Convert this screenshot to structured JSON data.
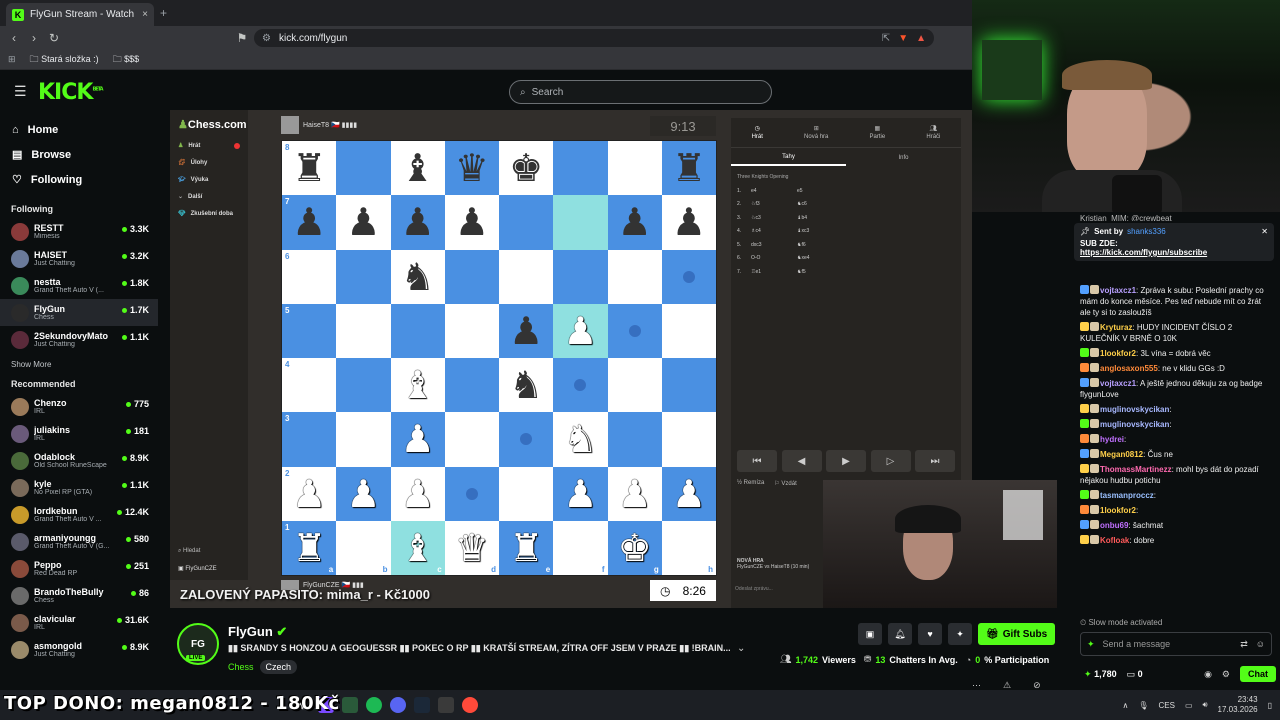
{
  "browser": {
    "tab_title": "FlyGun Stream - Watch Live o...",
    "tab_close": "×",
    "new_tab": "+",
    "url": "kick.com/flygun",
    "bookmarks": [
      "Stará složka :)",
      "$$$"
    ]
  },
  "kick": {
    "logo": "KICK",
    "logo_beta": "BETA",
    "search_placeholder": "Search"
  },
  "sidebar": {
    "nav": [
      {
        "label": "Home",
        "icon": "home-icon",
        "glyph": "⌂"
      },
      {
        "label": "Browse",
        "icon": "browse-icon",
        "glyph": "▤"
      },
      {
        "label": "Following",
        "icon": "heart-icon",
        "glyph": "♡"
      }
    ],
    "following_title": "Following",
    "following": [
      {
        "name": "RESTT",
        "sub": "Mimesis",
        "viewers": "3.3K",
        "color": "#8a3a3a"
      },
      {
        "name": "HAISET",
        "sub": "Just Chatting",
        "viewers": "3.2K",
        "color": "#6a7a9a"
      },
      {
        "name": "nestta",
        "sub": "Grand Theft Auto V (...",
        "viewers": "1.8K",
        "color": "#3a8a5a"
      },
      {
        "name": "FlyGun",
        "sub": "Chess",
        "viewers": "1.7K",
        "color": "#2a2a2a"
      },
      {
        "name": "2SekundovyMato",
        "sub": "Just Chatting",
        "viewers": "1.1K",
        "color": "#5a2a3a"
      }
    ],
    "show_more": "Show More",
    "recommended_title": "Recommended",
    "recommended": [
      {
        "name": "Chenzo",
        "sub": "IRL",
        "viewers": "775",
        "color": "#9a7a5a"
      },
      {
        "name": "juliakins",
        "sub": "IRL",
        "viewers": "181",
        "color": "#6a5a7a"
      },
      {
        "name": "Odablock",
        "sub": "Old School RuneScape",
        "viewers": "8.9K",
        "color": "#4a6a3a"
      },
      {
        "name": "kyle",
        "sub": "No Pixel RP (GTA)",
        "viewers": "1.1K",
        "color": "#7a6a5a"
      },
      {
        "name": "lordkebun",
        "sub": "Grand Theft Auto V ...",
        "viewers": "12.4K",
        "color": "#c89a2a"
      },
      {
        "name": "armaniyoungg",
        "sub": "Grand Theft Auto V (G...",
        "viewers": "580",
        "color": "#5a5a6a"
      },
      {
        "name": "Peppo",
        "sub": "Red Dead RP",
        "viewers": "251",
        "color": "#8a4a3a"
      },
      {
        "name": "BrandoTheBully",
        "sub": "Chess",
        "viewers": "86",
        "color": "#6a6a6a"
      },
      {
        "name": "clavicular",
        "sub": "IRL",
        "viewers": "31.6K",
        "color": "#7a5a4a"
      },
      {
        "name": "asmongold",
        "sub": "Just Chatting",
        "viewers": "8.9K",
        "color": "#9a8a6a"
      }
    ]
  },
  "chess": {
    "site": "Chess.com",
    "side_menu": [
      "Hrát",
      "Úlohy",
      "Výuka",
      "Další",
      "Zkušební doba"
    ],
    "side_bottom": [
      "Hledat",
      "FlyGunCZE"
    ],
    "opponent": "HaiseT8 🇨🇿 ▮▮▮▮",
    "player": "FlyGunCZE 🇨🇿 ▮▮▮",
    "clock_top": "9:13",
    "clock_bottom": "8:26",
    "board": [
      [
        "br",
        "",
        "bb",
        "bq",
        "bk",
        "",
        "",
        "br"
      ],
      [
        "bp",
        "bp",
        "bp",
        "bp",
        "",
        "hl",
        "bp",
        "bp"
      ],
      [
        "",
        "",
        "bn",
        "",
        "",
        "",
        "",
        "dot"
      ],
      [
        "",
        "",
        "",
        "",
        "bp",
        "wp*",
        "dot",
        ""
      ],
      [
        "",
        "",
        "wb",
        "",
        "bn",
        "dot",
        "",
        ""
      ],
      [
        "",
        "",
        "wp",
        "",
        "dot",
        "wn",
        "",
        ""
      ],
      [
        "wp",
        "wp",
        "wp",
        "dot",
        "",
        "wp",
        "wp",
        "wp"
      ],
      [
        "wr",
        "",
        "wb*",
        "wq",
        "wr",
        "",
        "wk",
        ""
      ]
    ],
    "files": [
      "a",
      "b",
      "c",
      "d",
      "e",
      "f",
      "g",
      "h"
    ],
    "ranks": [
      "8",
      "7",
      "6",
      "5",
      "4",
      "3",
      "2",
      "1"
    ],
    "panel_tabs": [
      "Hrát",
      "Nová hra",
      "Partie",
      "Hráči"
    ],
    "subtabs": [
      "Tahy",
      "Info"
    ],
    "opening": "Three Knights Opening",
    "moves": [
      [
        "1.",
        "e4",
        "e5"
      ],
      [
        "2.",
        "♘f3",
        "♞c6"
      ],
      [
        "3.",
        "♘c3",
        "♝b4"
      ],
      [
        "4.",
        "♗c4",
        "♝xc3"
      ],
      [
        "5.",
        "dxc3",
        "♞f6"
      ],
      [
        "6.",
        "O-O",
        "♞xe4"
      ],
      [
        "7.",
        "♖e1",
        "♞f5"
      ]
    ],
    "nav_buttons": [
      "⏮",
      "◀",
      "▶",
      "▷",
      "⏭"
    ],
    "draw": "Remíza",
    "resign": "Vzdát",
    "new_game_title": "NOVÁ HRA",
    "new_game_sub": "FlyGunCZE vs HaiseT8 (10 min)",
    "send_msg": "Odeslat zprávu..."
  },
  "overlay_banner": "ZALOVENÝ PAPASITO: mima_r - Kč1000",
  "stream": {
    "channel": "FlyGun",
    "title": "▮▮ SRANDY S HONZOU A GEOGUESSR  ▮▮ POKEC O RP  ▮▮ KRATŠÍ STREAM, ZÍTRA OFF JSEM V PRAZE  ▮▮ !BRAIN...",
    "category": "Chess",
    "language": "Czech",
    "viewers": "1,742",
    "viewers_label": "Viewers",
    "chatters": "13",
    "chatters_label": "Chatters In Avg.",
    "participation": "0",
    "participation_label": "% Participation",
    "gift_subs": "Gift Subs"
  },
  "chat": {
    "pinned_top": "Kristian_MIM: @crewbeat",
    "sent_by": "Sent by",
    "sent_user": "shanks336",
    "pinned_text": "SUB ZDE:",
    "pinned_link": "https://kick.com/flygun/subscribe",
    "messages": [
      {
        "user": "vojtaxcz1",
        "color": "#b8a0ff",
        "text": ": Zpráva k subu: Poslední prachy co mám do konce měsíce. Pes teď nebude mít co žrát ale ty si to zasloužíš"
      },
      {
        "user": "Kryturaz",
        "color": "#ffd04a",
        "text": ": HUDY INCIDENT ČÍSLO 2 KULEČNÍK V BRNĚ O 10K"
      },
      {
        "user": "1lookfor2",
        "color": "#ffd04a",
        "text": ": 3L vína = dobrá věc"
      },
      {
        "user": "anglosaxon555",
        "color": "#ff8a3a",
        "text": ": ne v klidu GGs :D"
      },
      {
        "user": "vojtaxcz1",
        "color": "#b8a0ff",
        "text": ": A ještě jednou děkuju za og badge flygunLove"
      },
      {
        "user": "muglinovskycikan",
        "color": "#a8b8ff",
        "text": ":"
      },
      {
        "user": "muglinovskycikan",
        "color": "#a8b8ff",
        "text": ":"
      },
      {
        "user": "hydrei",
        "color": "#c070ff",
        "text": ":"
      },
      {
        "user": "Megan0812",
        "color": "#ffd04a",
        "text": ": Čus ne"
      },
      {
        "user": "ThomassMartinezz",
        "color": "#ff6ab0",
        "text": ": mohl bys dát do pozadí nějakou hudbu potichu"
      },
      {
        "user": "tasmanproccz",
        "color": "#9ac0ff",
        "text": ":"
      },
      {
        "user": "1lookfor2",
        "color": "#ffd04a",
        "text": ":"
      },
      {
        "user": "onbu69",
        "color": "#c070ff",
        "text": ": šachmat"
      },
      {
        "user": "Kofloak",
        "color": "#ff5a5a",
        "text": ": dobre"
      }
    ],
    "slow_mode": "Slow mode activated",
    "input_placeholder": "Send a message",
    "points": "1,780",
    "zero": "0",
    "chat_button": "Chat"
  },
  "taskbar": {
    "top_dono": "TOP DONO: megan0812 - 180Kč",
    "lang": "CES",
    "time": "23:43",
    "date": "17.03.2026"
  },
  "colors": {
    "kick_green": "#53fc18",
    "light_square": "#ffffff",
    "dark_square": "#4a90e2",
    "highlight": "#8fe0e0"
  }
}
